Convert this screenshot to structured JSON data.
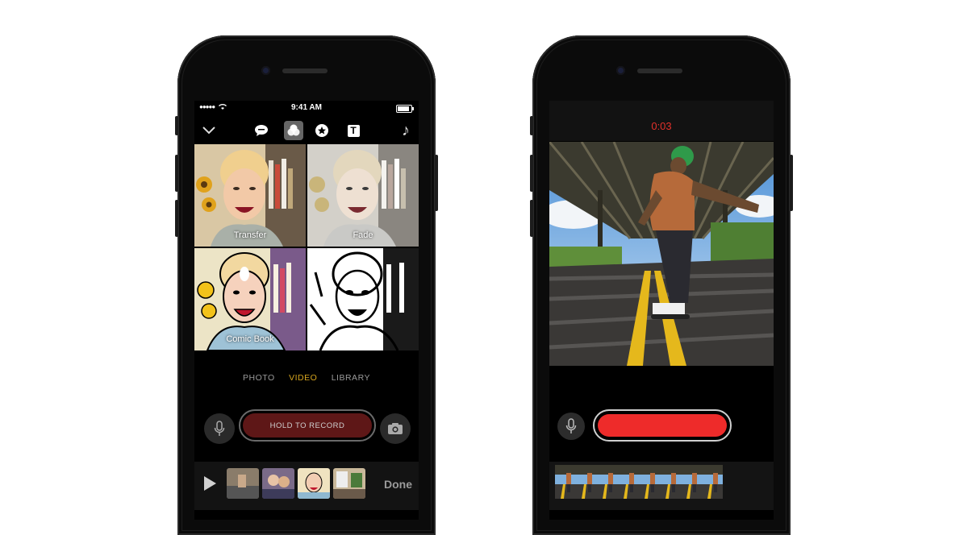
{
  "left_phone": {
    "status": {
      "time": "9:41 AM",
      "signal": "●●●●●"
    },
    "toolbar": {
      "items": [
        {
          "name": "chevron-down-icon"
        },
        {
          "name": "speech-bubble-icon"
        },
        {
          "name": "filters-icon",
          "selected": true
        },
        {
          "name": "star-icon"
        },
        {
          "name": "text-icon",
          "glyph": "T"
        },
        {
          "name": "music-note-icon",
          "glyph": "♪"
        }
      ]
    },
    "filters": [
      {
        "label": "Transfer"
      },
      {
        "label": "Fade"
      },
      {
        "label": "Comic Book"
      },
      {
        "label": ""
      }
    ],
    "modes": {
      "photo": "PHOTO",
      "video": "VIDEO",
      "library": "LIBRARY",
      "active": "video"
    },
    "record_button": "HOLD TO RECORD",
    "timeline": {
      "done": "Done",
      "clips": 4
    }
  },
  "right_phone": {
    "timer": "0:03",
    "record_color": "#ee2b2a",
    "strip_frames": 8
  },
  "colors": {
    "accent_video": "#d6a51e",
    "record_red": "#ee2b2a",
    "hold_dark_red": "#5e1717"
  }
}
